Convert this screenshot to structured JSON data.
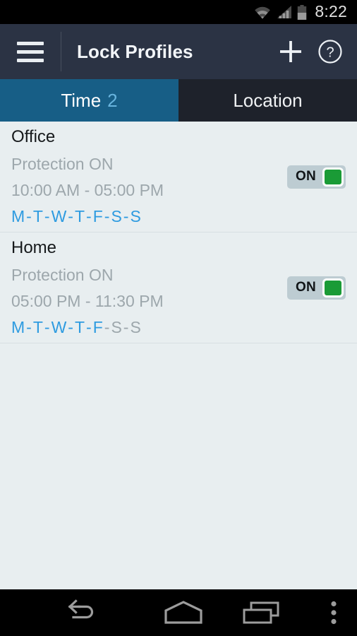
{
  "status_bar": {
    "time": "8:22",
    "icons": [
      "wifi-icon",
      "cellular-signal-icon",
      "battery-icon"
    ]
  },
  "app_bar": {
    "menu_icon": "hamburger-menu-icon",
    "title": "Lock Profiles",
    "add_icon": "plus-icon",
    "help_icon": "help-circle-icon"
  },
  "tabs": [
    {
      "label": "Time",
      "count": "2",
      "active": true
    },
    {
      "label": "Location",
      "count": "",
      "active": false
    }
  ],
  "profiles": [
    {
      "name": "Office",
      "protection": "Protection ON",
      "time_range": "10:00 AM - 05:00 PM",
      "days": [
        {
          "letter": "M",
          "on": true
        },
        {
          "letter": "T",
          "on": true
        },
        {
          "letter": "W",
          "on": true
        },
        {
          "letter": "T",
          "on": true
        },
        {
          "letter": "F",
          "on": true
        },
        {
          "letter": "S",
          "on": true
        },
        {
          "letter": "S",
          "on": true
        }
      ],
      "toggle_label": "ON",
      "toggle_on": true
    },
    {
      "name": "Home",
      "protection": "Protection ON",
      "time_range": "05:00 PM - 11:30 PM",
      "days": [
        {
          "letter": "M",
          "on": true
        },
        {
          "letter": "T",
          "on": true
        },
        {
          "letter": "W",
          "on": true
        },
        {
          "letter": "T",
          "on": true
        },
        {
          "letter": "F",
          "on": true
        },
        {
          "letter": "S",
          "on": false
        },
        {
          "letter": "S",
          "on": false
        }
      ],
      "toggle_label": "ON",
      "toggle_on": true
    }
  ],
  "nav_bar": {
    "back_icon": "back-arrow-icon",
    "home_icon": "home-icon",
    "recents_icon": "recent-apps-icon",
    "overflow_icon": "overflow-menu-icon"
  },
  "colors": {
    "app_bar": "#2B3344",
    "tab_active": "#175E86",
    "tab_inactive": "#1E222B",
    "tab_count": "#68B4DE",
    "list_bg": "#E8EEF0",
    "day_on": "#2E9BE0",
    "day_off": "#9DA7AC",
    "toggle_track": "#BDCCD2",
    "toggle_thumb": "#1A9B36"
  }
}
